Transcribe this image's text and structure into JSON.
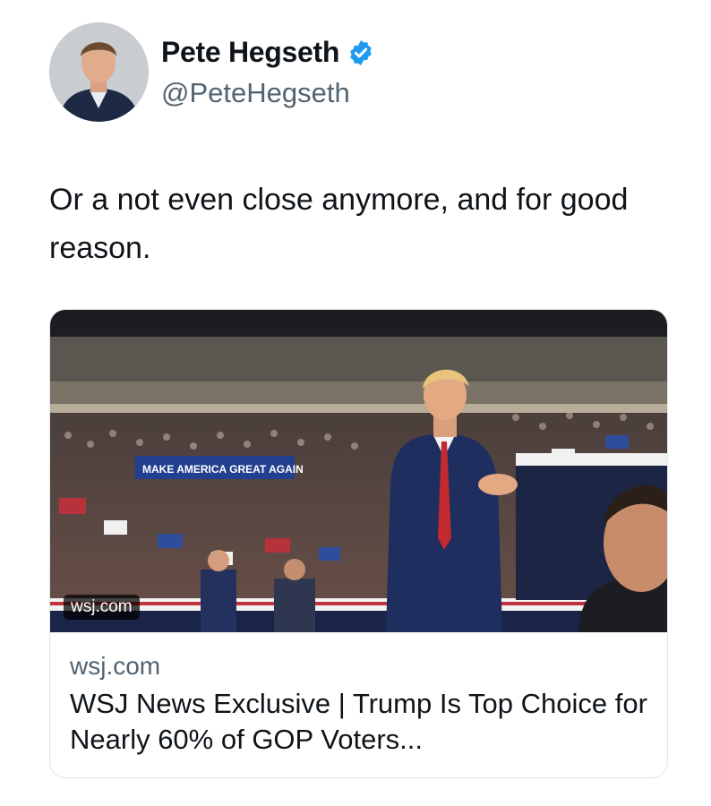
{
  "author": {
    "display_name": "Pete Hegseth",
    "handle": "@PeteHegseth",
    "verified_icon": "verified-badge-icon",
    "verified_color": "#1d9bf0"
  },
  "tweet": {
    "text": "Or a not even close anymore, and for good reason."
  },
  "link_card": {
    "image_banner_text": "MAKE AMERICA GREAT AGAIN",
    "image_domain_badge": "wsj.com",
    "domain": "wsj.com",
    "title": "WSJ News Exclusive | Trump Is Top Choice for Nearly 60% of GOP Voters..."
  }
}
